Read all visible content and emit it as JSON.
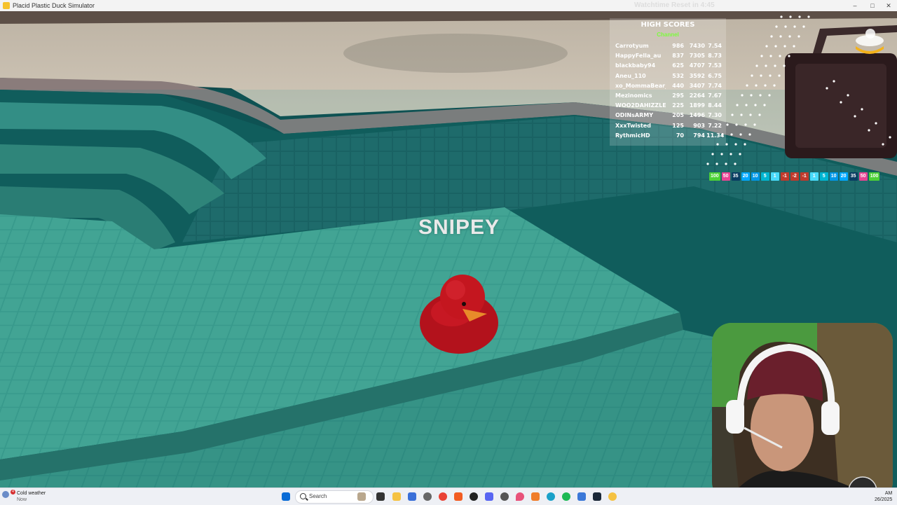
{
  "window": {
    "title": "Placid Plastic Duck Simulator",
    "controls": [
      "–",
      "□",
      "✕"
    ]
  },
  "game": {
    "reset_text": "Watchtime Reset in 4:45",
    "duck_name": "SNIPEY",
    "high_scores": {
      "title": "HIGH SCORES",
      "subtitle": "Channel",
      "rows": [
        {
          "name": "Carrotyum",
          "a": "986",
          "b": "7430",
          "c": "7.54"
        },
        {
          "name": "HappyFella_au",
          "a": "837",
          "b": "7305",
          "c": "8.73"
        },
        {
          "name": "blackbaby94",
          "a": "625",
          "b": "4707",
          "c": "7.53"
        },
        {
          "name": "Aneu_110",
          "a": "532",
          "b": "3592",
          "c": "6.75"
        },
        {
          "name": "xo_MommaBear_o",
          "a": "440",
          "b": "3407",
          "c": "7.74"
        },
        {
          "name": "Mezinomics",
          "a": "295",
          "b": "2264",
          "c": "7.67"
        },
        {
          "name": "WOO2DAHIZZLE",
          "a": "225",
          "b": "1899",
          "c": "8.44"
        },
        {
          "name": "ODINsARMY",
          "a": "205",
          "b": "1496",
          "c": "7.30"
        },
        {
          "name": "XxxTwisted",
          "a": "125",
          "b": "903",
          "c": "7.22"
        },
        {
          "name": "RythmicHD",
          "a": "70",
          "b": "794",
          "c": "11.34"
        }
      ]
    },
    "value_chips": [
      {
        "label": "100",
        "color": "#4cd137"
      },
      {
        "label": "50",
        "color": "#e84393"
      },
      {
        "label": "35",
        "color": "#0a3d62"
      },
      {
        "label": "20",
        "color": "#00a8ff"
      },
      {
        "label": "10",
        "color": "#0097e6"
      },
      {
        "label": "5",
        "color": "#00b5d1"
      },
      {
        "label": "1",
        "color": "#48dbfb"
      },
      {
        "label": "-1",
        "color": "#c0392b"
      },
      {
        "label": "-2",
        "color": "#c0392b"
      },
      {
        "label": "-1",
        "color": "#c0392b"
      },
      {
        "label": "1",
        "color": "#48dbfb"
      },
      {
        "label": "5",
        "color": "#00b5d1"
      },
      {
        "label": "10",
        "color": "#0097e6"
      },
      {
        "label": "20",
        "color": "#00a8ff"
      },
      {
        "label": "35",
        "color": "#0a3d62"
      },
      {
        "label": "50",
        "color": "#e84393"
      },
      {
        "label": "100",
        "color": "#4cd137"
      }
    ]
  },
  "taskbar": {
    "weather_title": "Cold weather",
    "weather_sub": "Now",
    "weather_badge": "4",
    "search_placeholder": "Search",
    "time": "AM",
    "date": "26/2025",
    "icons": [
      "start-icon",
      "search-icon",
      "copilot-icon",
      "taskview-icon",
      "file-explorer-icon",
      "photos-icon",
      "settings-icon",
      "chrome-icon",
      "brave-icon",
      "obs-icon",
      "discord-icon",
      "settings-gear-icon",
      "maps-pin-icon",
      "notepad-icon",
      "edge-icon",
      "spotify-icon",
      "store-icon",
      "steam-icon",
      "duck-game-icon"
    ]
  }
}
